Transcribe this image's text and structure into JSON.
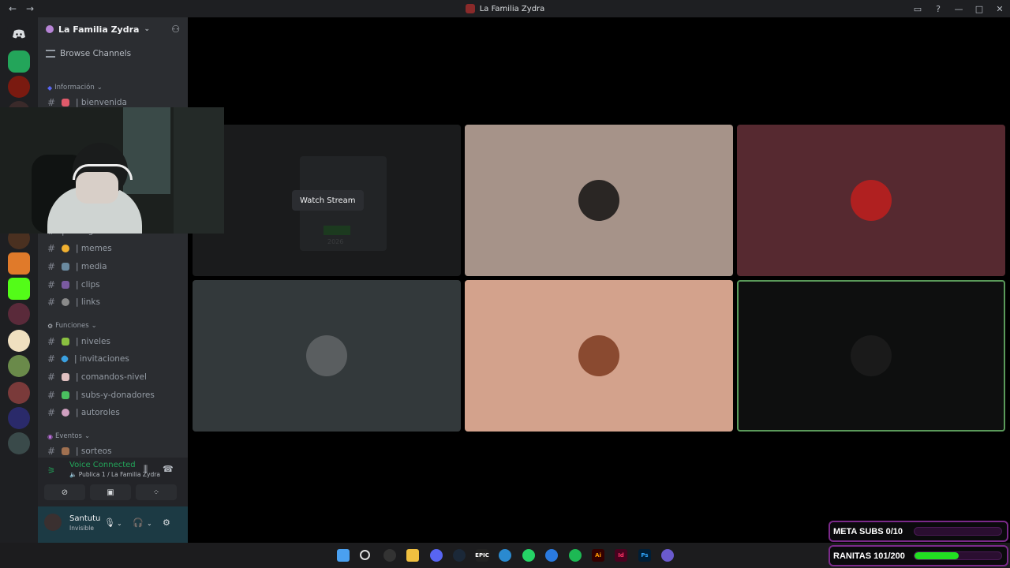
{
  "window": {
    "title": "La Familia Zydra",
    "back": "←",
    "forward": "→",
    "inbox": "▭",
    "help": "?",
    "min": "—",
    "max": "□",
    "close": "✕"
  },
  "server": {
    "name": "La Familia Zydra",
    "chevron": "⌄",
    "invite_icon": "person-add-icon"
  },
  "browse_label": "Browse Channels",
  "categories": {
    "info": "Información",
    "funciones": "Funciones",
    "eventos": "Eventos"
  },
  "channels": {
    "bienvenida": "| bienvenida",
    "chat_general": "| chat-general",
    "memes": "| memes",
    "media": "| media",
    "clips": "| clips",
    "links": "| links",
    "niveles": "| niveles",
    "invitaciones": "| invitaciones",
    "comandos": "| comandos-nivel",
    "subs": "| subs-y-donadores",
    "autoroles": "| autoroles",
    "sorteos": "| sorteos"
  },
  "voice": {
    "status": "Voice Connected",
    "channel": "Publica 1 / La Familia Zydra"
  },
  "user": {
    "name": "Santutu",
    "status": "Invisible"
  },
  "stage": {
    "watch_label": "Watch Stream",
    "stream_year": "2026"
  },
  "goals": [
    {
      "label": "META SUBS 0/10",
      "current": 0,
      "target": 10
    },
    {
      "label": "RANITAS 101/200",
      "current": 101,
      "target": 200
    }
  ],
  "colors": {
    "accent_green": "#23a55a",
    "goal_border": "#7b2a8a",
    "goal_fill": "#22e022"
  },
  "taskbar_icons": [
    "windows-start-icon",
    "search-icon",
    "obs-icon",
    "file-explorer-icon",
    "discord-icon",
    "steam-icon",
    "epic-games-icon",
    "edge-icon",
    "whatsapp-icon",
    "bluetooth-icon",
    "spotify-icon",
    "illustrator-icon",
    "indesign-icon",
    "photoshop-icon",
    "app-icon"
  ],
  "taskbar_text": {
    "epic": "EPIC",
    "ai": "Ai",
    "id": "Id",
    "ps": "Ps"
  }
}
